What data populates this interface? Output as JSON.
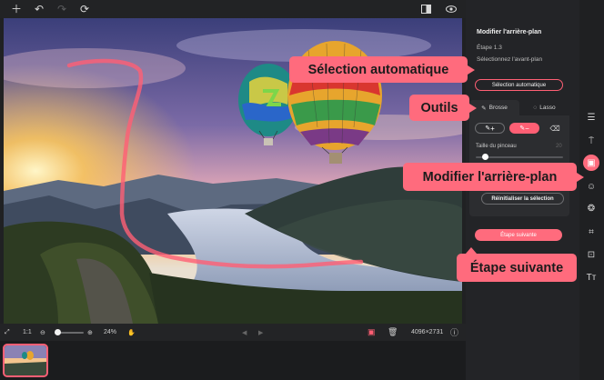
{
  "toolbar": {
    "icons": [
      "plus-icon",
      "undo-icon",
      "redo-icon",
      "refresh-icon",
      "compare-icon",
      "eye-icon",
      "save-icon"
    ]
  },
  "panel": {
    "title": "Modifier l'arrière-plan",
    "step": "Étape 1.3",
    "subtitle": "Sélectionnez l'avant-plan",
    "auto_select_button": "Sélection automatique",
    "tabs": [
      {
        "label": "Brosse",
        "active": true
      },
      {
        "label": "Lasso",
        "active": false
      }
    ],
    "brush_add": "+",
    "brush_subtract": "−",
    "brush_size_label": "Taille du pinceau",
    "brush_size_value": "20",
    "brush_size_fraction": 0.1,
    "reset_button": "Réinitialiser la sélection",
    "next_button": "Étape suivante"
  },
  "bottom": {
    "ratio": "1:1",
    "zoom": "24%",
    "zoom_fraction": 0.1,
    "dimensions": "4096×2731"
  },
  "callouts": {
    "auto_select": "Sélection automatique",
    "tools": "Outils",
    "modify_bg": "Modifier l'arrière-plan",
    "next_step": "Étape suivante"
  },
  "colors": {
    "accent": "#ff6b7d",
    "panel_bg": "#232427",
    "app_bg": "#202123"
  }
}
